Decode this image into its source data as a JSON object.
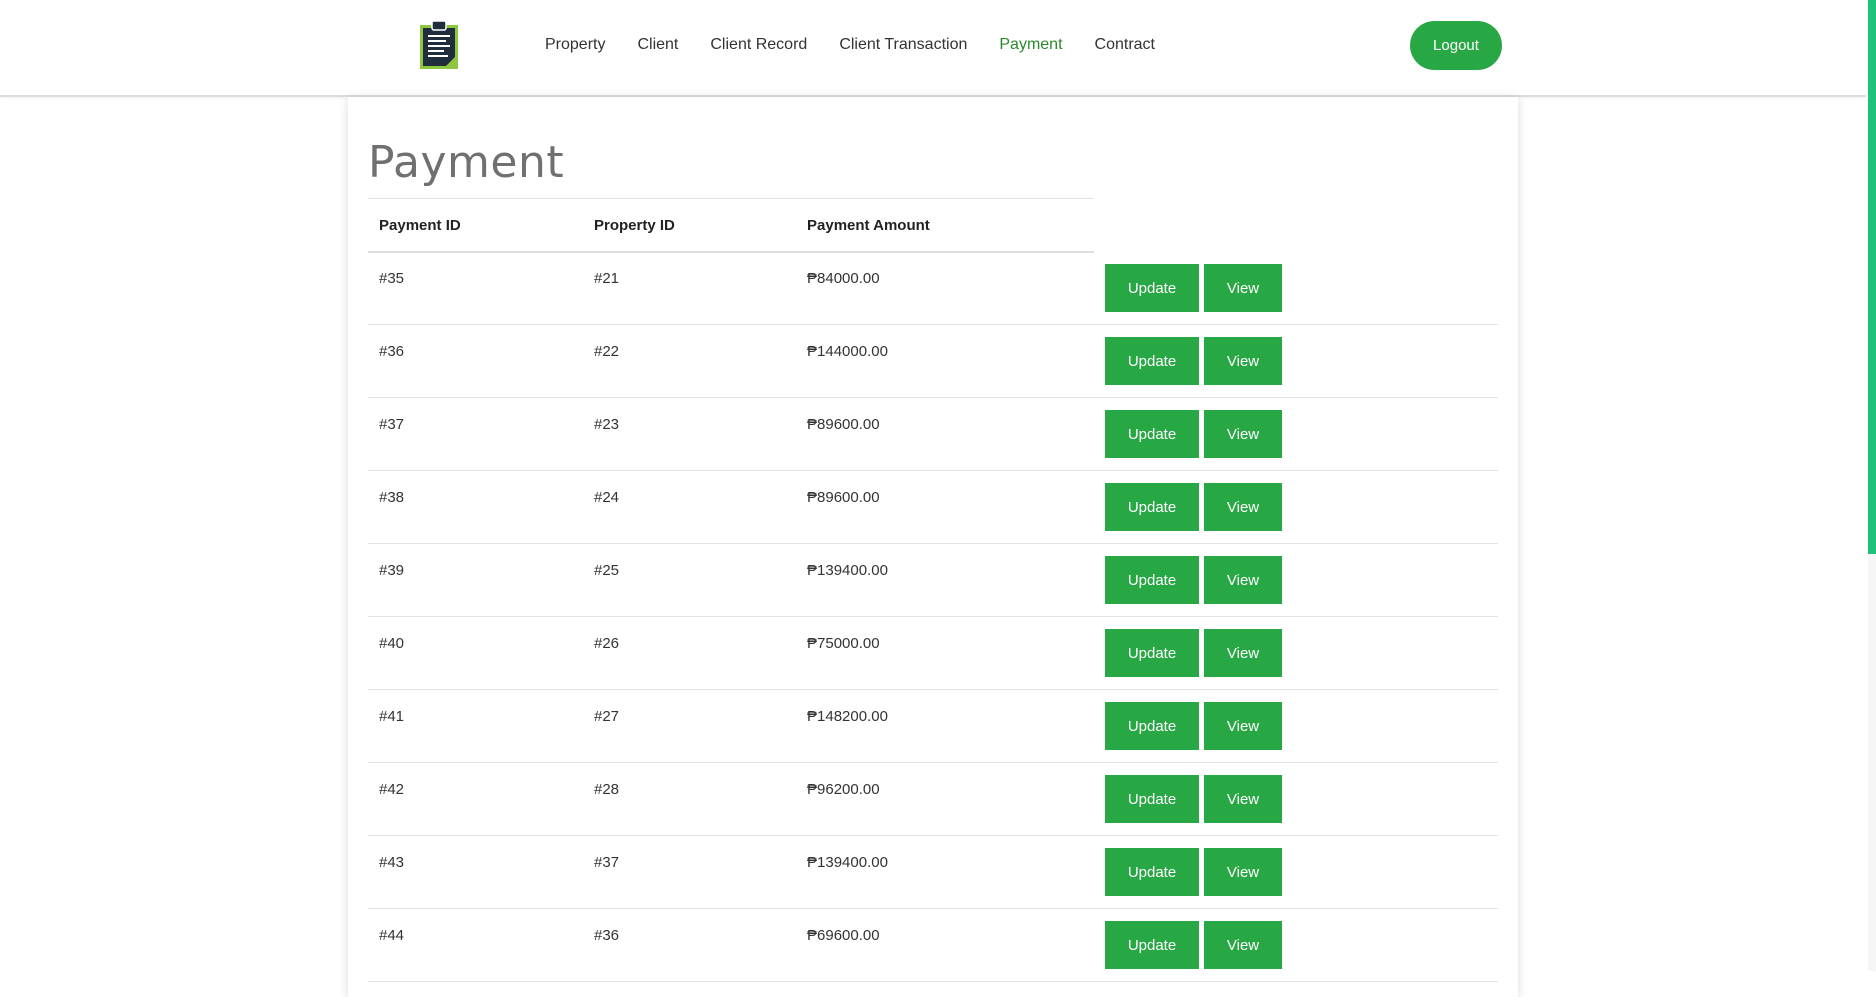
{
  "nav": {
    "items": [
      {
        "label": "Property",
        "active": false
      },
      {
        "label": "Client",
        "active": false
      },
      {
        "label": "Client Record",
        "active": false
      },
      {
        "label": "Client Transaction",
        "active": false
      },
      {
        "label": "Payment",
        "active": true
      },
      {
        "label": "Contract",
        "active": false
      }
    ],
    "logout_label": "Logout"
  },
  "page": {
    "title": "Payment"
  },
  "table": {
    "columns": [
      "Payment ID",
      "Property ID",
      "Payment Amount"
    ],
    "update_label": "Update",
    "view_label": "View",
    "rows": [
      {
        "payment_id": "#35",
        "property_id": "#21",
        "amount": "₱84000.00"
      },
      {
        "payment_id": "#36",
        "property_id": "#22",
        "amount": "₱144000.00"
      },
      {
        "payment_id": "#37",
        "property_id": "#23",
        "amount": "₱89600.00"
      },
      {
        "payment_id": "#38",
        "property_id": "#24",
        "amount": "₱89600.00"
      },
      {
        "payment_id": "#39",
        "property_id": "#25",
        "amount": "₱139400.00"
      },
      {
        "payment_id": "#40",
        "property_id": "#26",
        "amount": "₱75000.00"
      },
      {
        "payment_id": "#41",
        "property_id": "#27",
        "amount": "₱148200.00"
      },
      {
        "payment_id": "#42",
        "property_id": "#28",
        "amount": "₱96200.00"
      },
      {
        "payment_id": "#43",
        "property_id": "#37",
        "amount": "₱139400.00"
      },
      {
        "payment_id": "#44",
        "property_id": "#36",
        "amount": "₱69600.00"
      }
    ]
  },
  "colors": {
    "accent": "#28a745",
    "active_nav": "#2a8a2a",
    "scroll_thumb": "#1fc27a"
  },
  "icons": {
    "logo": "clipboard-icon"
  }
}
